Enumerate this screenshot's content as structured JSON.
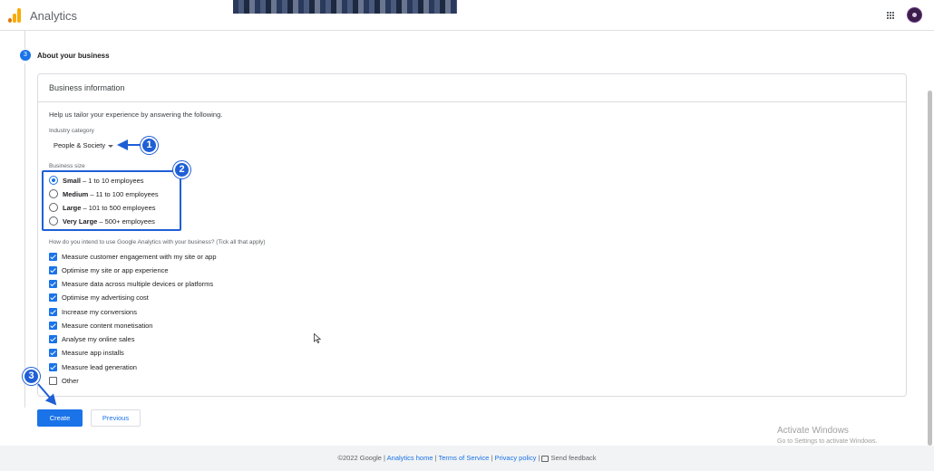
{
  "app": {
    "title": "Analytics"
  },
  "step": {
    "number": "3",
    "title": "About your business"
  },
  "card": {
    "title": "Business information",
    "intro": "Help us tailor your experience by answering the following.",
    "industry": {
      "label": "Industry category",
      "value": "People & Society"
    },
    "business_size": {
      "label": "Business size",
      "options": [
        {
          "bold": "Small",
          "rest": "– 1 to 10 employees",
          "selected": true
        },
        {
          "bold": "Medium",
          "rest": "– 11 to 100 employees",
          "selected": false
        },
        {
          "bold": "Large",
          "rest": "– 101 to 500 employees",
          "selected": false
        },
        {
          "bold": "Very Large",
          "rest": "– 500+ employees",
          "selected": false
        }
      ]
    },
    "usage": {
      "label": "How do you intend to use Google Analytics with your business? (Tick all that apply)",
      "options": [
        {
          "label": "Measure customer engagement with my site or app",
          "checked": true
        },
        {
          "label": "Optimise my site or app experience",
          "checked": true
        },
        {
          "label": "Measure data across multiple devices or platforms",
          "checked": true
        },
        {
          "label": "Optimise my advertising cost",
          "checked": true
        },
        {
          "label": "Increase my conversions",
          "checked": true
        },
        {
          "label": "Measure content monetisation",
          "checked": true
        },
        {
          "label": "Analyse my online sales",
          "checked": true
        },
        {
          "label": "Measure app installs",
          "checked": true
        },
        {
          "label": "Measure lead generation",
          "checked": true
        },
        {
          "label": "Other",
          "checked": false
        }
      ]
    }
  },
  "buttons": {
    "create": "Create",
    "previous": "Previous"
  },
  "annotations": {
    "badge1": "1",
    "badge2": "2",
    "badge3": "3",
    "color": "#1f5fd6"
  },
  "watermark": {
    "line1": "Activate Windows",
    "line2": "Go to Settings to activate Windows."
  },
  "footer": {
    "copyright": "©2022 Google",
    "analytics_home": "Analytics home",
    "terms": "Terms of Service",
    "privacy": "Privacy policy",
    "feedback": "Send feedback"
  },
  "colors": {
    "accent": "#1a73e8"
  }
}
